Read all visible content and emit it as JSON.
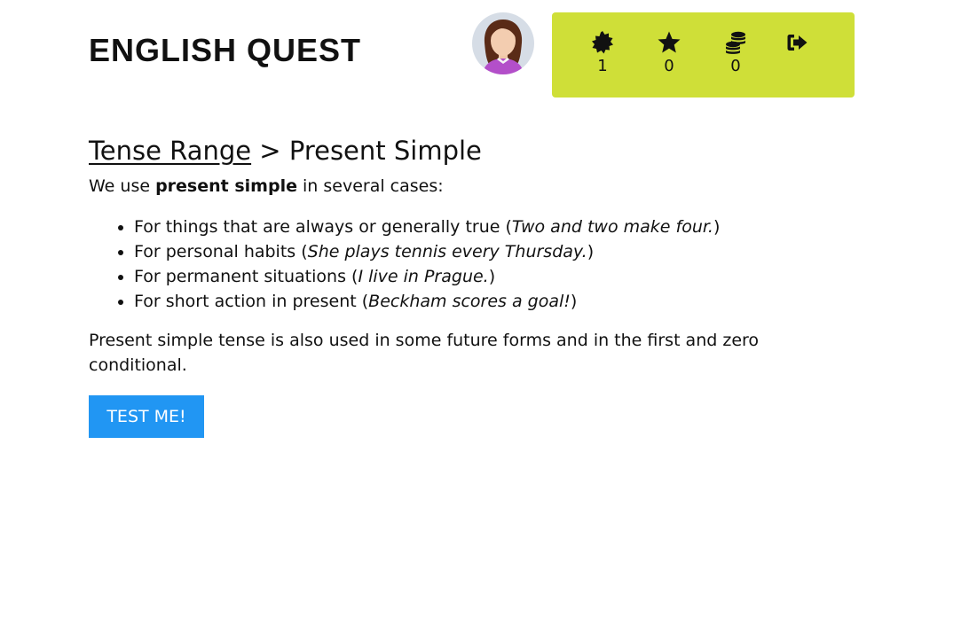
{
  "header": {
    "logo": "ENGLISH QUEST",
    "stats": [
      {
        "icon": "badge-icon",
        "value": "1"
      },
      {
        "icon": "star-icon",
        "value": "0"
      },
      {
        "icon": "coins-icon",
        "value": "0"
      },
      {
        "icon": "logout-icon"
      }
    ],
    "accent_color": "#cfdf38"
  },
  "breadcrumb": {
    "parent": "Tense Range",
    "separator": " > ",
    "current": "Present Simple"
  },
  "content": {
    "intro_prefix": "We use ",
    "intro_bold": "present simple",
    "intro_suffix": " in several cases:",
    "items": [
      {
        "text": "For things that are always or generally true (",
        "example": "Two and two make four.",
        "close": ")"
      },
      {
        "text": "For personal habits (",
        "example": "She plays tennis every Thursday.",
        "close": ")"
      },
      {
        "text": "For permanent situations (",
        "example": "I live in Prague.",
        "close": ")"
      },
      {
        "text": "For short action in present (",
        "example": "Beckham scores a goal!",
        "close": ")"
      }
    ],
    "outro": "Present simple tense is also used in some future forms and in the first and zero conditional."
  },
  "button": {
    "label": "TEST ME!",
    "color": "#2196f3"
  }
}
